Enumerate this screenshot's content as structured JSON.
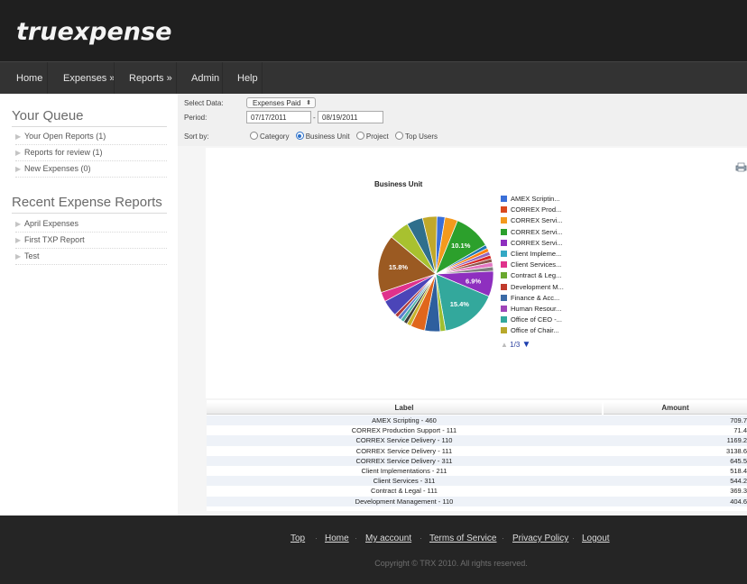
{
  "app": {
    "logo_text": "truexpense"
  },
  "nav": {
    "items": [
      "Home",
      "Expenses »",
      "Reports »",
      "Admin",
      "Help"
    ]
  },
  "sidebar": {
    "queue_title": "Your Queue",
    "queue_items": [
      "Your Open Reports (1)",
      "Reports for review (1)",
      "New Expenses (0)"
    ],
    "recent_title": "Recent Expense Reports",
    "recent_items": [
      "April Expenses",
      "First TXP Report",
      "Test"
    ]
  },
  "filters": {
    "select_label": "Select Data:",
    "select_value": "Expenses Paid",
    "period_label": "Period:",
    "date_from": "07/17/2011",
    "date_sep": "-",
    "date_to": "08/19/2011",
    "sort_label": "Sort by:",
    "sort_options": [
      "Category",
      "Business Unit",
      "Project",
      "Top Users"
    ],
    "sort_selected": "Business Unit"
  },
  "chart_data": {
    "type": "pie",
    "title": "Business Unit",
    "legend": [
      "AMEX Scriptin...",
      "CORREX Prod...",
      "CORREX Servi...",
      "CORREX Servi...",
      "CORREX Servi...",
      "Client Impleme...",
      "Client Services...",
      "Contract & Leg...",
      "Development M...",
      "Finance & Acc...",
      "Human Resour...",
      "Office of CEO -...",
      "Office of Chair..."
    ],
    "slices": [
      {
        "value": 2.2,
        "color": "#3a6fd8"
      },
      {
        "value": 3.5,
        "color": "#f39a1e"
      },
      {
        "value": 10.1,
        "color": "#2ca02c",
        "label": "10.1%"
      },
      {
        "value": 1.0,
        "color": "#1f77b4"
      },
      {
        "value": 1.0,
        "color": "#ff7f0e"
      },
      {
        "value": 1.0,
        "color": "#9467bd"
      },
      {
        "value": 1.0,
        "color": "#d62728"
      },
      {
        "value": 1.0,
        "color": "#8c564b"
      },
      {
        "value": 1.2,
        "color": "#e377c2"
      },
      {
        "value": 1.2,
        "color": "#7f7f7f"
      },
      {
        "value": 6.9,
        "color": "#8e2fbf",
        "label": "6.9%"
      },
      {
        "value": 15.4,
        "color": "#33a89c",
        "label": "15.4%"
      },
      {
        "value": 1.5,
        "color": "#9fbf2f"
      },
      {
        "value": 4.2,
        "color": "#2e5f9e"
      },
      {
        "value": 3.9,
        "color": "#e0661c"
      },
      {
        "value": 1.2,
        "color": "#c7b42c"
      },
      {
        "value": 1.0,
        "color": "#3d3d3d"
      },
      {
        "value": 1.0,
        "color": "#4fb3a6"
      },
      {
        "value": 1.0,
        "color": "#5a7fd0"
      },
      {
        "value": 1.0,
        "color": "#b03a3a"
      },
      {
        "value": 4.5,
        "color": "#4b45b8"
      },
      {
        "value": 2.6,
        "color": "#e0328c"
      },
      {
        "value": 15.8,
        "color": "#9b5a22",
        "label": "15.8%"
      },
      {
        "value": 5.5,
        "color": "#a8c12f"
      },
      {
        "value": 4.4,
        "color": "#2f6f8c"
      },
      {
        "value": 3.9,
        "color": "#c0a82a"
      }
    ],
    "legend_colors": [
      "#3a6fd8",
      "#d9491e",
      "#f39a1e",
      "#2ca02c",
      "#8e2fbf",
      "#33a8c4",
      "#e0328c",
      "#6aa82f",
      "#c03a2c",
      "#3b6aa6",
      "#9e45b8",
      "#33a89c",
      "#b8a82a"
    ],
    "pager": "1/3"
  },
  "table": {
    "headers": [
      "Label",
      "Amount"
    ],
    "rows": [
      {
        "label": "AMEX Scripting - 460",
        "amount": "709.7"
      },
      {
        "label": "CORREX Production Support - 111",
        "amount": "71.4"
      },
      {
        "label": "CORREX Service Delivery - 110",
        "amount": "1169.2"
      },
      {
        "label": "CORREX Service Delivery - 111",
        "amount": "3138.6"
      },
      {
        "label": "CORREX Service Delivery - 311",
        "amount": "645.5"
      },
      {
        "label": "Client Implementations - 211",
        "amount": "518.4"
      },
      {
        "label": "Client Services - 311",
        "amount": "544.2"
      },
      {
        "label": "Contract & Legal - 111",
        "amount": "369.3"
      },
      {
        "label": "Development Management - 110",
        "amount": "404.6"
      }
    ]
  },
  "footer": {
    "links": [
      "Top",
      "Home",
      "My account",
      "Terms of Service",
      "Privacy Policy",
      "Logout"
    ],
    "copyright": "Copyright © TRX 2010. All rights reserved."
  }
}
